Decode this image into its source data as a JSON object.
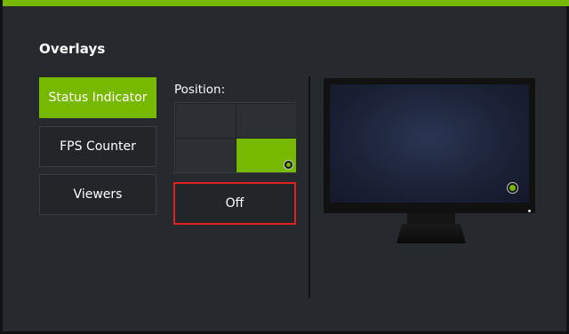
{
  "overlays": {
    "title": "Overlays",
    "items": [
      {
        "label": "Status Indicator",
        "active": true
      },
      {
        "label": "FPS Counter",
        "active": false
      },
      {
        "label": "Viewers",
        "active": false
      }
    ]
  },
  "position": {
    "label": "Position:",
    "selected": "bottom-right",
    "off_label": "Off"
  },
  "colors": {
    "accent": "#76b900",
    "panel": "#26292d",
    "highlight_border": "#e0211f"
  },
  "icons": {
    "indicator": "status-indicator-icon"
  }
}
